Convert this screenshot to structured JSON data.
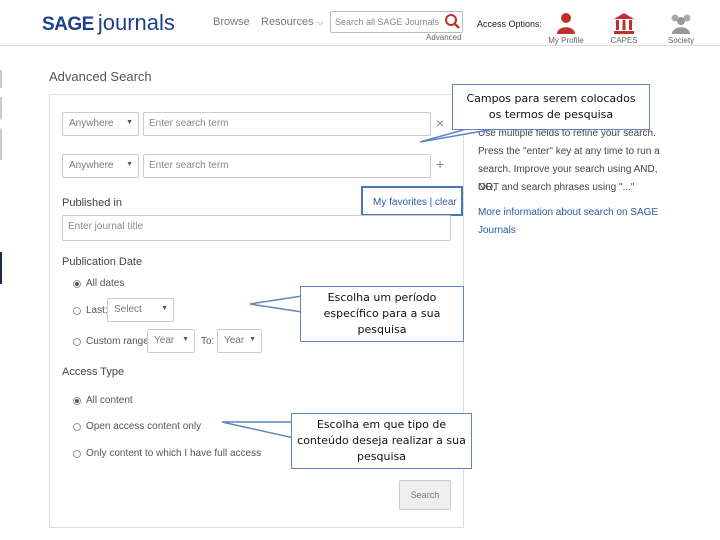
{
  "header": {
    "logo_sage": "SAGE",
    "logo_journals": "journals",
    "nav": {
      "browse": "Browse",
      "resources": "Resources"
    },
    "search_placeholder": "Search all SAGE Journals",
    "advanced": "Advanced",
    "access_options": "Access Options:",
    "account": [
      {
        "label": "My Profile",
        "icon": "person-icon",
        "color": "#c0302a"
      },
      {
        "label": "CAPES",
        "icon": "institution-icon",
        "color": "#c0302a"
      },
      {
        "label": "Society",
        "icon": "society-icon",
        "color": "#aaaaaa"
      }
    ]
  },
  "page_title": "Advanced Search",
  "search_rows": [
    {
      "field": "Anywhere",
      "placeholder": "Enter search term",
      "action": "×"
    },
    {
      "field": "Anywhere",
      "placeholder": "Enter search term",
      "action": "+"
    }
  ],
  "published_in": {
    "label": "Published in",
    "favorites": "My favorites | clear",
    "placeholder": "Enter journal title"
  },
  "publication_date": {
    "label": "Publication Date",
    "all_dates": "All dates",
    "last": "Last:",
    "last_select": "Select",
    "custom_range": "Custom range:",
    "from_year": "Year",
    "to": "To:",
    "to_year": "Year",
    "selected": "all_dates"
  },
  "access_type": {
    "label": "Access Type",
    "options": [
      "All content",
      "Open access content only",
      "Only content to which I have full access"
    ],
    "selected": 0
  },
  "search_button": "Search",
  "help": {
    "text": "Use multiple fields to refine your search. Press the \"enter\" key at any time to run a search. Improve your search using AND, OR, NOT and search phrases using \"...\"",
    "line1": "Use multiple fields to refine your search.",
    "line2": "Press the \"enter\" key at any time to run a",
    "line3": "search. Improve your search using AND, OR,",
    "line4": "NOT and search phrases using \"...\"",
    "link": "More information about search on SAGE Journals"
  },
  "callouts": {
    "fields": "Campos para serem colocados os termos de pesquisa",
    "period": "Escolha um período específico para a sua pesquisa",
    "access": "Escolha em que tipo de conteúdo deseja realizar a sua pesquisa"
  },
  "colors": {
    "brand": "#1d3f8c",
    "link": "#2a5aa5",
    "callout_border": "#5f86c3",
    "highlight_border": "#4a76b8"
  }
}
